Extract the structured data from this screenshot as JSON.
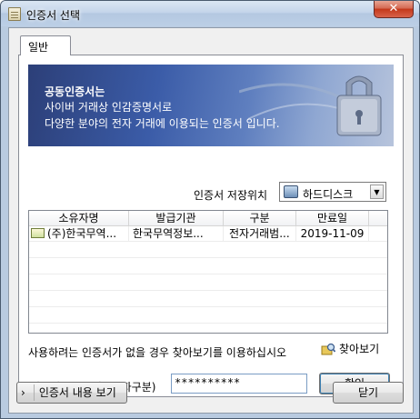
{
  "window": {
    "title": "인증서 선택",
    "close_glyph": "✕"
  },
  "tabs": [
    {
      "label": "일반"
    }
  ],
  "banner": {
    "line1": "공동인증서는",
    "line2": "사이버 거래상 인감증명서로",
    "line3": "다양한 분야의 전자 거래에 이용되는 인증서 입니다."
  },
  "storage": {
    "label": "인증서 저장위치",
    "value": "하드디스크",
    "icon": "hard-disk-icon"
  },
  "table": {
    "columns": [
      "소유자명",
      "발급기관",
      "구분",
      "만료일"
    ],
    "rows": [
      {
        "owner": "(주)한국무역...",
        "issuer": "한국무역정보...",
        "type": "전자거래범...",
        "expiry": "2019-11-09"
      }
    ]
  },
  "notice": "사용하려는 인증서가 없을 경우 찾아보기를 이용하십시오",
  "find_button": {
    "label": "찾아보기",
    "icon": "folder-search-icon"
  },
  "password": {
    "label": "인증서 암호 (대소문자구분)",
    "value": "**********"
  },
  "buttons": {
    "ok": "확인",
    "details": "인증서 내용 보기",
    "details_chevron": "›",
    "close": "닫기"
  },
  "colors": {
    "banner_dark": "#2c3f78",
    "banner_light": "#b7c4dc",
    "close_red": "#c3381a"
  }
}
